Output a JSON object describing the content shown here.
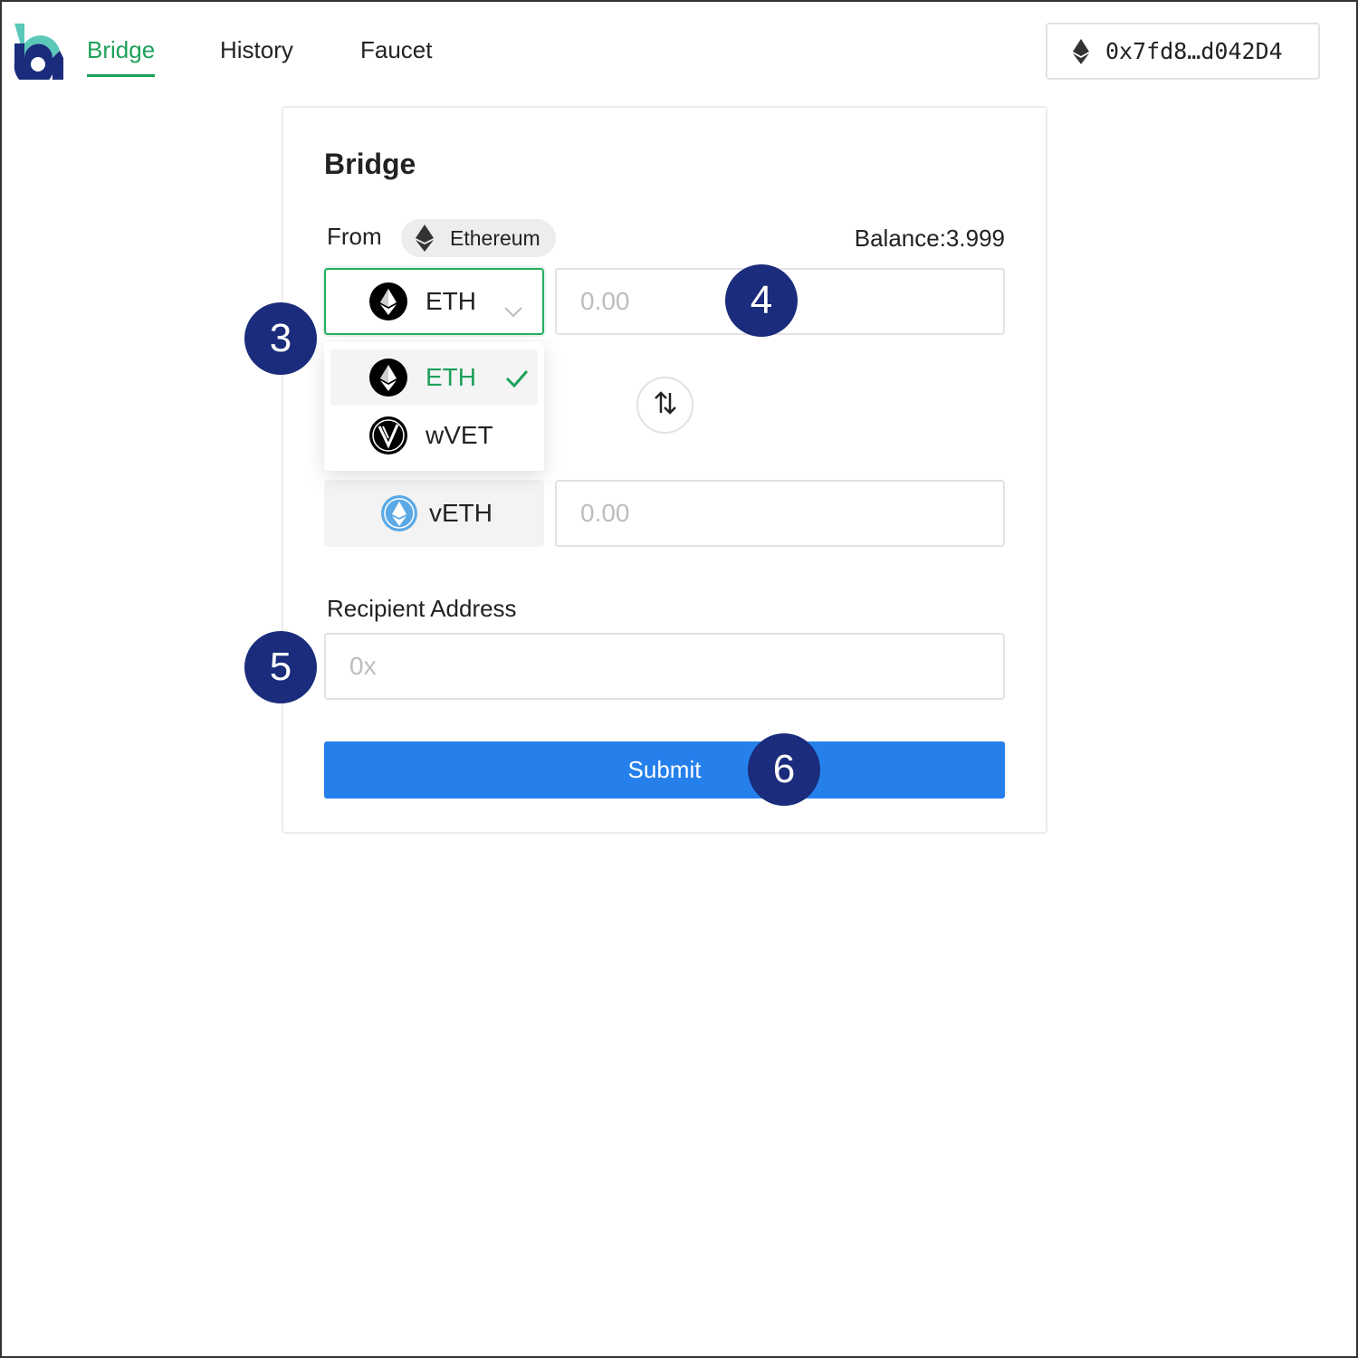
{
  "nav": {
    "items": [
      {
        "label": "Bridge",
        "active": true
      },
      {
        "label": "History",
        "active": false
      },
      {
        "label": "Faucet",
        "active": false
      }
    ],
    "wallet_address": "0x7fd8…d042D4",
    "accent_color": "#1ea05a"
  },
  "bridge": {
    "title": "Bridge",
    "from_label": "From",
    "from_chain": "Ethereum",
    "balance": "Balance:3.999",
    "from_token": {
      "symbol": "ETH",
      "icon": "eth-icon"
    },
    "from_amount_placeholder": "0.00",
    "token_options": [
      {
        "symbol": "ETH",
        "icon": "eth-icon",
        "selected": true
      },
      {
        "symbol": "wVET",
        "icon": "vet-icon",
        "selected": false
      }
    ],
    "swap_icon": "swap-arrows-icon",
    "to_token": {
      "symbol": "vETH",
      "icon": "veth-icon"
    },
    "to_amount_placeholder": "0.00",
    "recipient_label": "Recipient Address",
    "recipient_placeholder": "0x",
    "submit_label": "Submit",
    "submit_color": "#2680eb"
  },
  "markers": [
    "3",
    "4",
    "5",
    "6"
  ],
  "marker_color": "#1a2c7b"
}
